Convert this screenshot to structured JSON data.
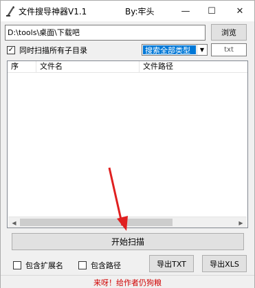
{
  "window": {
    "title": "文件搜导神器V1.1",
    "author": "By:牢头",
    "controls": {
      "minimize": "—",
      "maximize": "☐",
      "close": "✕"
    }
  },
  "path": {
    "value": "D:\\tools\\桌面\\下载吧",
    "browse_label": "浏览"
  },
  "options": {
    "subdirs_label": "同时扫描所有子目录",
    "subdirs_checked": true,
    "type_select_value": "搜索全部类型",
    "ext_placeholder": "txt"
  },
  "list": {
    "columns": [
      "序",
      "文件名",
      "文件路径"
    ]
  },
  "actions": {
    "start_label": "开始扫描",
    "include_ext_label": "包含扩展名",
    "include_path_label": "包含路径",
    "export_txt_label": "导出TXT",
    "export_xls_label": "导出XLS"
  },
  "status": {
    "text": "来呀！给作者仍狗粮"
  },
  "colors": {
    "selection": "#0078d7",
    "status_text": "#d00000",
    "annotation_arrow": "#e02020"
  },
  "icons": {
    "app": "quill-pen-icon",
    "dropdown": "chevron-down-icon"
  }
}
